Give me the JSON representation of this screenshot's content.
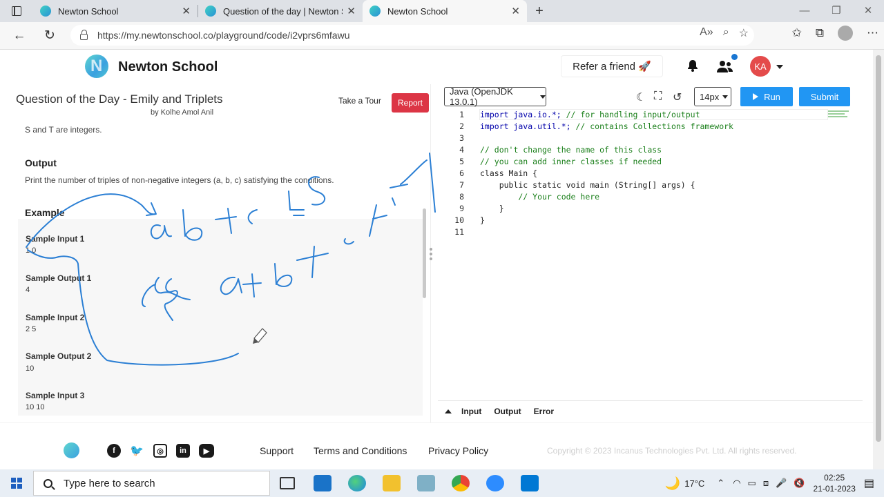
{
  "browser": {
    "tabs": [
      {
        "title": "Newton School"
      },
      {
        "title": "Question of the day | Newton Sc"
      },
      {
        "title": "Newton School"
      }
    ],
    "url": "https://my.newtonschool.co/playground/code/i2vprs6mfawu"
  },
  "header": {
    "brand": "Newton School",
    "refer_label": "Refer a friend 🚀",
    "avatar_initials": "KA"
  },
  "problem": {
    "title": "Question of the Day - Emily and Triplets",
    "author": "by Kolhe Amol Anil",
    "tour_label": "Take a Tour",
    "report_label": "Report",
    "constraint_text": "S and T are integers.",
    "output_heading": "Output",
    "output_text": "Print the number of triples of non-negative integers (a, b, c) satisfying the conditions.",
    "example_heading": "Example",
    "samples": [
      {
        "label": "Sample Input 1",
        "value": "1 0"
      },
      {
        "label": "Sample Output 1",
        "value": "4"
      },
      {
        "label": "Sample Input 2",
        "value": "2 5"
      },
      {
        "label": "Sample Output 2",
        "value": "10"
      },
      {
        "label": "Sample Input 3",
        "value": "10 10"
      }
    ]
  },
  "editor": {
    "language": "Java (OpenJDK 13.0.1)",
    "font_size": "14px",
    "run_label": "Run",
    "submit_label": "Submit",
    "lines": [
      "1",
      "2",
      "3",
      "4",
      "5",
      "6",
      "7",
      "8",
      "9",
      "10",
      "11"
    ],
    "code": {
      "l1_kw": "import java.io.*;",
      "l1_cm": " // for handling input/output",
      "l2_kw": "import java.util.*;",
      "l2_cm": " // contains Collections framework",
      "l4": "// don't change the name of this class",
      "l5": "// you can add inner classes if needed",
      "l6": "class Main {",
      "l7": "    public static void main (String[] args) {",
      "l8": "        // Your code here",
      "l9": "    }",
      "l10": "}"
    },
    "console_tabs": [
      "Input",
      "Output",
      "Error"
    ]
  },
  "footer": {
    "links": [
      "Support",
      "Terms and Conditions",
      "Privacy Policy"
    ],
    "copyright": "Copyright © 2023 Incanus Technologies Pvt. Ltd. All rights reserved.",
    "social_icons": [
      "facebook-icon",
      "twitter-icon",
      "instagram-icon",
      "linkedin-icon",
      "youtube-icon"
    ]
  },
  "taskbar": {
    "search_placeholder": "Type here to search",
    "temperature": "17°C",
    "time": "02:25",
    "date": "21-01-2023"
  },
  "colors": {
    "accent": "#2196f3",
    "report": "#dc3545",
    "ink": "#2b7fd4",
    "avatar": "#e44b4b"
  }
}
